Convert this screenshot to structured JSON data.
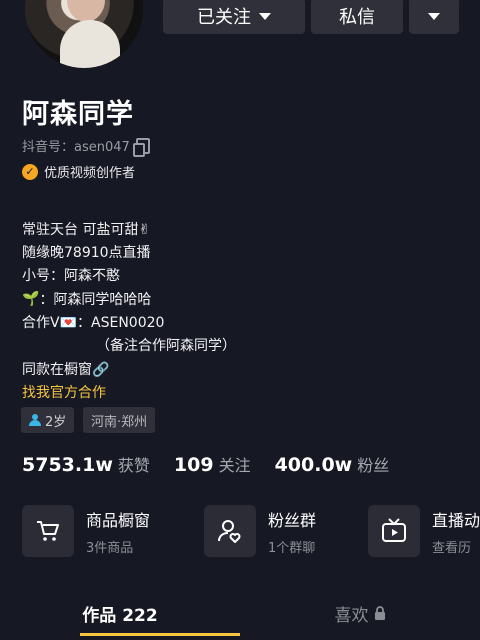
{
  "header": {
    "follow_label": "已关注",
    "message_label": "私信"
  },
  "profile": {
    "name": "阿森同学",
    "douyin_id": "抖音号：asen047",
    "badge": "优质视频创作者",
    "bio": [
      "常驻天台 可盐可甜✌",
      "随缘晚78910点直播",
      "小号：阿森不憨",
      "：阿森同学哈哈哈",
      "合作V💌：ASEN0020",
      "（备注合作阿森同学）",
      "同款在橱窗🔗"
    ],
    "official_link": "找我官方合作",
    "tags": [
      "2岁",
      "河南·郑州"
    ]
  },
  "stats": [
    {
      "value": "5753.1w",
      "label": "获赞"
    },
    {
      "value": "109",
      "label": "关注"
    },
    {
      "value": "400.0w",
      "label": "粉丝"
    }
  ],
  "features": [
    {
      "title": "商品橱窗",
      "subtitle": "3件商品",
      "icon": "cart-icon"
    },
    {
      "title": "粉丝群",
      "subtitle": "1个群聊",
      "icon": "fans-group-icon"
    },
    {
      "title": "直播动",
      "subtitle": "查看历",
      "icon": "live-tv-icon"
    }
  ],
  "tabs": [
    {
      "label": "作品 222",
      "active": true
    },
    {
      "label": "喜欢",
      "active": false,
      "locked": true
    }
  ],
  "colors": {
    "background": "#161823",
    "accent": "#f5c542",
    "badge": "#f5a623",
    "button": "#2f3039"
  }
}
